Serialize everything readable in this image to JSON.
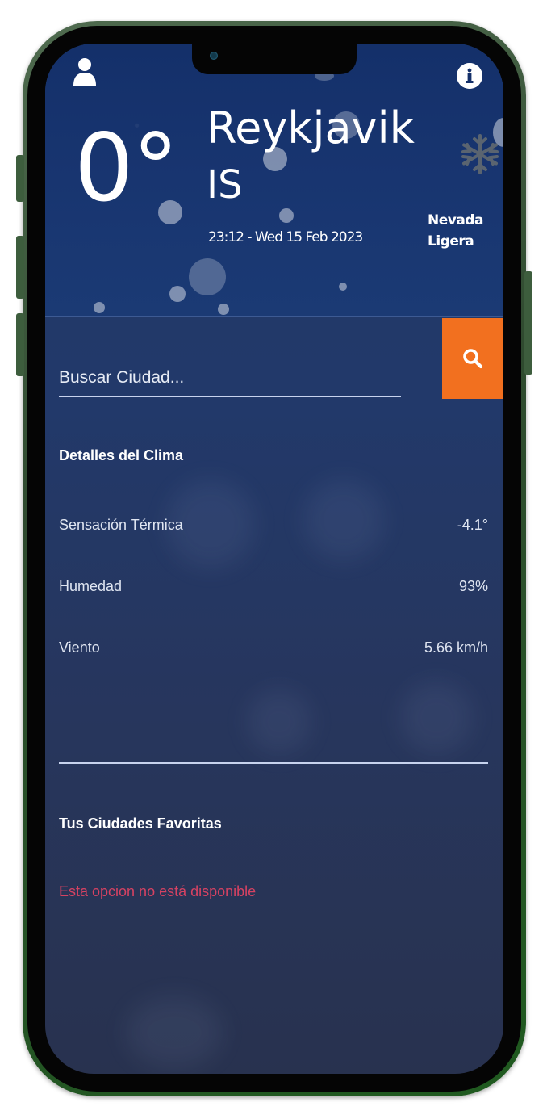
{
  "weather": {
    "temperature": "0°",
    "city": "Reykjavik",
    "country": "IS",
    "datetime": "23:12 - Wed 15 Feb 2023",
    "condition_line1": "Nevada",
    "condition_line2": "Ligera"
  },
  "search": {
    "placeholder": "Buscar Ciudad..."
  },
  "details": {
    "title": "Detalles del Clima",
    "rows": [
      {
        "label": "Sensación Térmica",
        "value": "-4.1°"
      },
      {
        "label": "Humedad",
        "value": "93%"
      },
      {
        "label": "Viento",
        "value": "5.66 km/h"
      }
    ]
  },
  "favorites": {
    "title": "Tus Ciudades Favoritas",
    "message": "Esta opcion no está disponible"
  },
  "icons": {
    "user": "user-icon",
    "info": "info-icon",
    "weather": "snowflake-icon",
    "search": "search-icon"
  },
  "colors": {
    "accent": "#f2701f",
    "warning": "#d64262",
    "header_bg": "#14306a",
    "frame": "#2f4a2f"
  }
}
